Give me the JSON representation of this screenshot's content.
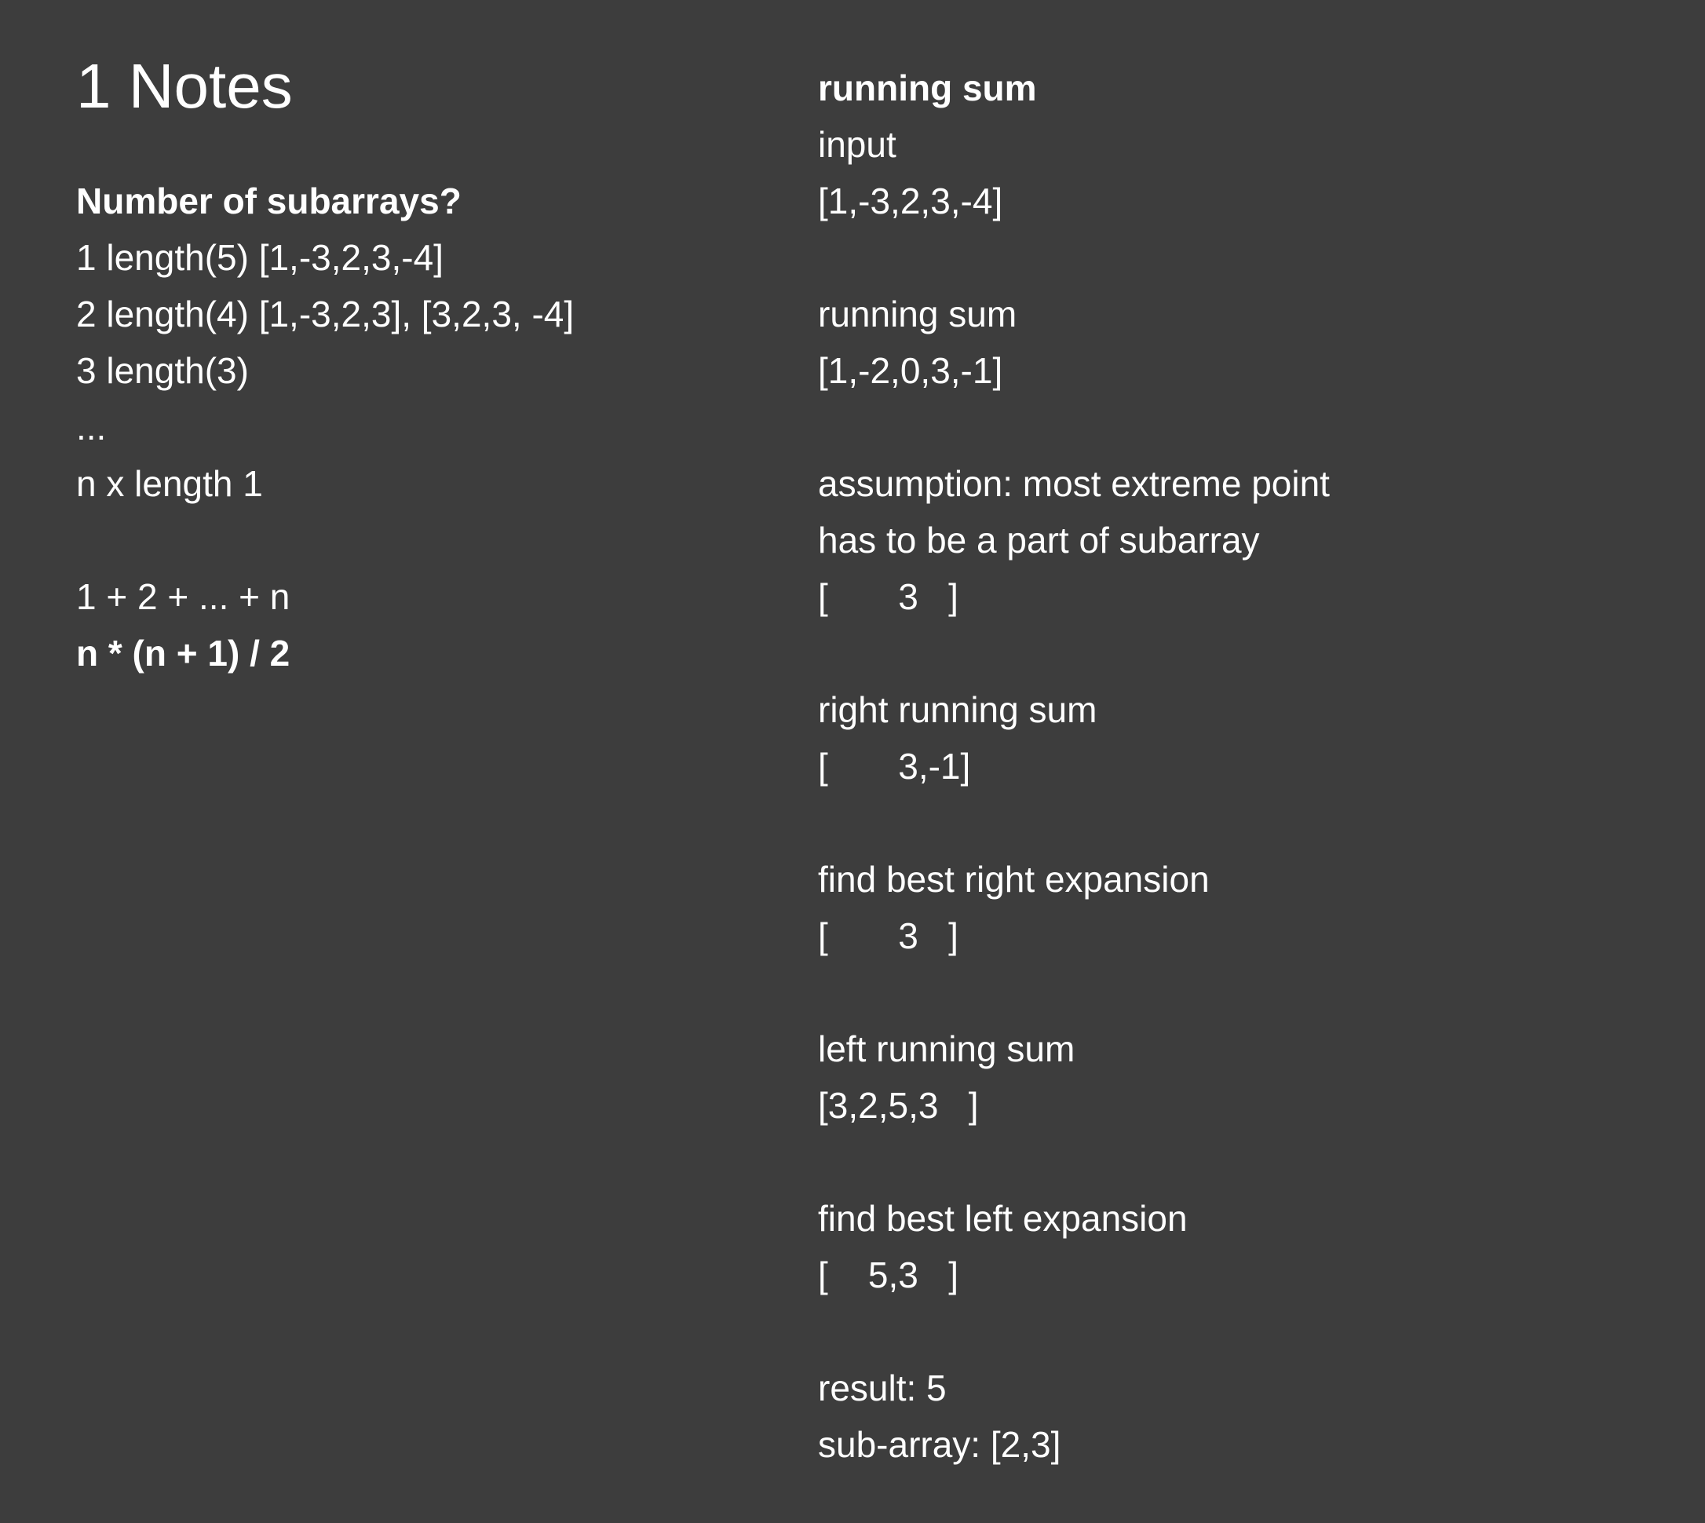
{
  "left": {
    "title": "1 Notes",
    "heading": "Number of subarrays?",
    "line1": "1 length(5) [1,-3,2,3,-4]",
    "line2": "2 length(4) [1,-3,2,3], [3,2,3, -4]",
    "line3": "3 length(3)",
    "ellipsis": "...",
    "line4": "n x length 1",
    "sum_expr": "1 + 2 + ... + n",
    "formula": "n * (n + 1) / 2"
  },
  "right": {
    "heading": "running sum",
    "input_label": "input",
    "input_value": "[1,-3,2,3,-4]",
    "running_label": "running sum",
    "running_value": "[1,-2,0,3,-1]",
    "assumption_line1": "assumption: most extreme point",
    "assumption_line2": "has to be a part of subarray",
    "assumption_value": "[       3   ]",
    "right_running_label": "right running sum",
    "right_running_value": "[       3,-1]",
    "best_right_label": "find best right expansion",
    "best_right_value": "[       3   ]",
    "left_running_label": "left running sum",
    "left_running_value": "[3,2,5,3   ]",
    "best_left_label": "find best left expansion",
    "best_left_value": "[    5,3   ]",
    "result": "result: 5",
    "subarray": "sub-array: [2,3]"
  }
}
